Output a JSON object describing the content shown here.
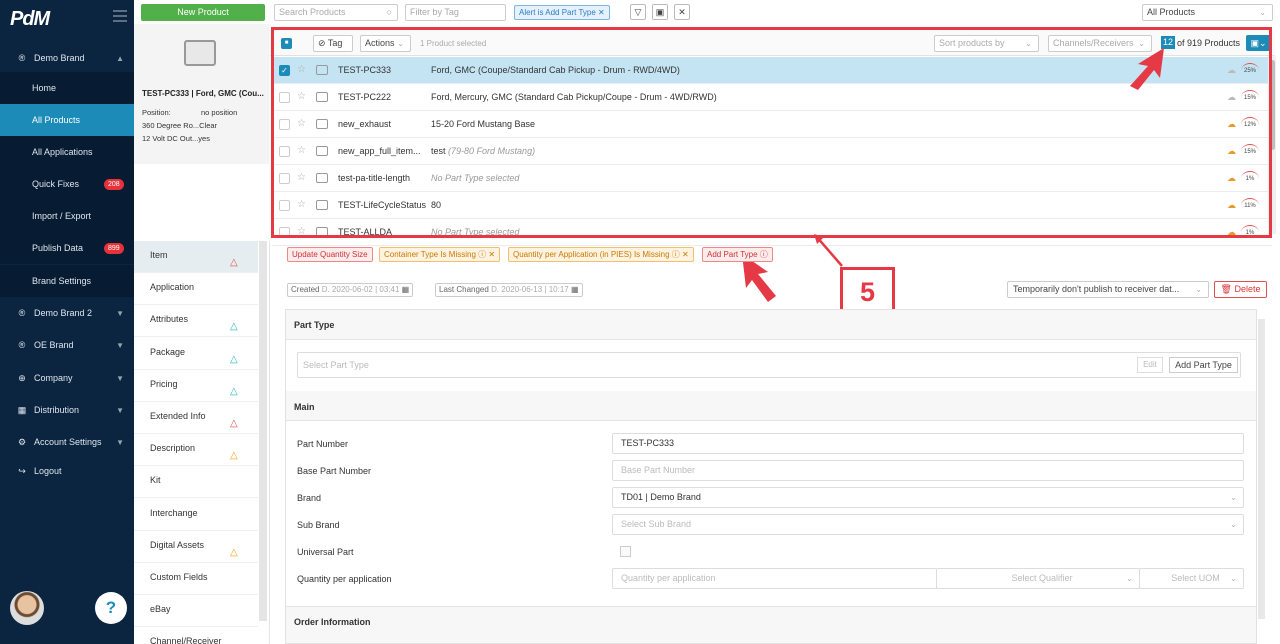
{
  "app": {
    "logo": "PdM"
  },
  "sidebar": {
    "items": [
      {
        "label": "Demo Brand",
        "icon": "®"
      },
      {
        "label": "Home"
      },
      {
        "label": "All Products"
      },
      {
        "label": "All Applications"
      },
      {
        "label": "Quick Fixes",
        "badge": "208"
      },
      {
        "label": "Import / Export"
      },
      {
        "label": "Publish Data",
        "badge": "899"
      },
      {
        "label": "Brand Settings"
      },
      {
        "label": "Demo Brand 2",
        "icon": "®"
      },
      {
        "label": "OE Brand",
        "icon": "®"
      },
      {
        "label": "Company",
        "icon": "⊕"
      },
      {
        "label": "Distribution",
        "icon": "▦"
      },
      {
        "label": "Account Settings",
        "icon": "⚙"
      },
      {
        "label": "Logout",
        "icon": "↪"
      }
    ],
    "help": "?"
  },
  "toolbar": {
    "new_product": "New Product",
    "search_placeholder": "Search Products",
    "filter_placeholder": "Filter by Tag",
    "filter_chip": "Alert is Add Part Type ✕",
    "all_products": "All Products"
  },
  "preview": {
    "title": "TEST-PC333 | Ford, GMC (Cou...",
    "rows": [
      {
        "k": "Position:",
        "v": "no position"
      },
      {
        "k": "360 Degree Ro...",
        "v": "Clear"
      },
      {
        "k": "12 Volt DC Out...",
        "v": "yes"
      }
    ]
  },
  "list": {
    "tag": "Tag",
    "actions": "Actions",
    "selected": "1 Product selected",
    "sort": "Sort products by",
    "channels": "Channels/Receivers",
    "count_shown": "12",
    "count_total": "of 919 Products",
    "rows": [
      {
        "pn": "TEST-PC333",
        "desc": "Ford, GMC (Coupe/Standard Cab Pickup - Drum - RWD/4WD)",
        "pct": "25%",
        "selected": true,
        "italic": false
      },
      {
        "pn": "TEST-PC222",
        "desc": "Ford, Mercury, GMC (Standard Cab Pickup/Coupe - Drum - 4WD/RWD)",
        "pct": "15%",
        "selected": false,
        "italic": false
      },
      {
        "pn": "new_exhaust",
        "desc": "15-20 Ford Mustang Base",
        "pct": "12%",
        "selected": false,
        "italic": false
      },
      {
        "pn": "new_app_full_item...",
        "desc": "test",
        "desc_extra": "(79-80 Ford Mustang)",
        "pct": "15%",
        "selected": false,
        "italic": false
      },
      {
        "pn": "test-pa-title-length",
        "desc": "No Part Type selected",
        "pct": "1%",
        "selected": false,
        "italic": true
      },
      {
        "pn": "TEST-LifeCycleStatus",
        "desc": "80",
        "pct": "11%",
        "selected": false,
        "italic": false
      },
      {
        "pn": "TEST-ALLDA",
        "desc": "No Part Type selected",
        "pct": "1%",
        "selected": false,
        "italic": true
      }
    ]
  },
  "tabs": [
    {
      "label": "Item",
      "warn": "red"
    },
    {
      "label": "Application"
    },
    {
      "label": "Attributes",
      "warn": "blue"
    },
    {
      "label": "Package",
      "warn": "blue"
    },
    {
      "label": "Pricing",
      "warn": "blue"
    },
    {
      "label": "Extended Info",
      "warn": "red"
    },
    {
      "label": "Description",
      "warn": "orange"
    },
    {
      "label": "Kit"
    },
    {
      "label": "Interchange"
    },
    {
      "label": "Digital Assets",
      "warn": "orange"
    },
    {
      "label": "Custom Fields"
    },
    {
      "label": "eBay"
    },
    {
      "label": "Channel/Receiver"
    }
  ],
  "alerts": [
    {
      "label": "Update Quantity Size"
    },
    {
      "label": "Container Type Is Missing ⓘ ✕"
    },
    {
      "label": "Quantity per Application (in PIES) Is Missing ⓘ ✕"
    },
    {
      "label": "Add Part Type ⓘ"
    }
  ],
  "detail": {
    "created_label": "Created",
    "created_value": "D. 2020-06-02 | 03:41",
    "changed_label": "Last Changed",
    "changed_value": "D. 2020-06-13 | 10:17",
    "publish": "Temporarily don't publish to receiver dat...",
    "delete": "Delete",
    "part_type_section": "Part Type",
    "part_type_placeholder": "Select Part Type",
    "edit": "Edit",
    "add_part_type": "Add Part Type",
    "main_section": "Main",
    "fields": [
      {
        "label": "Part Number",
        "value": "TEST-PC333"
      },
      {
        "label": "Base Part Number",
        "value": "Base Part Number"
      },
      {
        "label": "Brand",
        "value": "TD01 | Demo Brand"
      },
      {
        "label": "Sub Brand",
        "value": "Select Sub Brand"
      },
      {
        "label": "Universal Part",
        "value": ""
      },
      {
        "label": "Quantity per application",
        "value": "Quantity per application"
      }
    ],
    "qualifier": "Select Qualifier",
    "uom": "Select UOM",
    "order_section": "Order Information"
  },
  "annotation": {
    "step": "5"
  },
  "colors": {
    "sidebar": "#0b2540",
    "accent": "#1d8bb8",
    "new_button": "#52b04b",
    "highlight": "#e63946"
  }
}
